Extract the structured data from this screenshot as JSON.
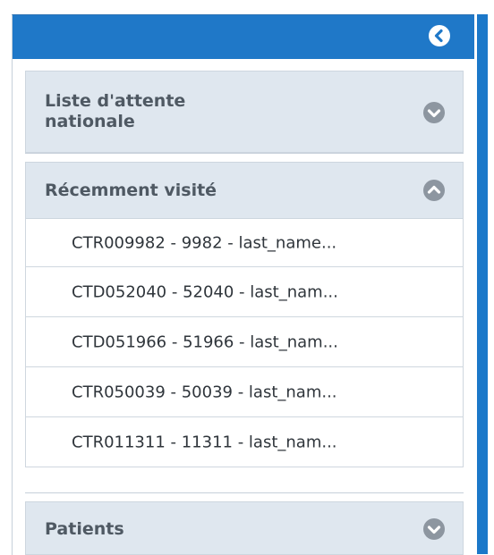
{
  "sidebar": {
    "collapse_icon": "chevron-left-circle-icon",
    "accent_color": "#1f78c8",
    "sections": [
      {
        "label": "Liste d'attente\nnationale",
        "expanded": false,
        "icon": "chevron-down-circle-icon"
      },
      {
        "label": "Récemment visité",
        "expanded": true,
        "icon": "chevron-up-circle-icon",
        "items": [
          {
            "label": "CTR009982 - 9982 - last_name..."
          },
          {
            "label": "CTD052040 - 52040 - last_nam..."
          },
          {
            "label": "CTD051966 - 51966 - last_nam..."
          },
          {
            "label": "CTR050039 - 50039 - last_nam..."
          },
          {
            "label": "CTR011311 - 11311 - last_nam..."
          }
        ]
      },
      {
        "label": "Patients",
        "expanded": false,
        "icon": "chevron-down-circle-icon"
      }
    ]
  }
}
